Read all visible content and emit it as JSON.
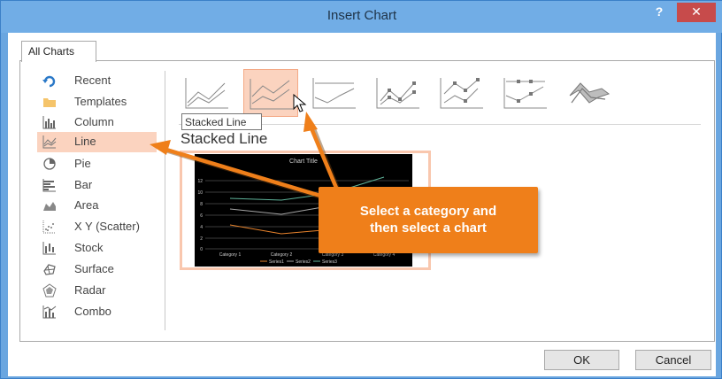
{
  "window": {
    "title": "Insert Chart",
    "help_label": "?",
    "close_label": "✕"
  },
  "tabs": [
    {
      "label": "All Charts"
    }
  ],
  "sidebar": {
    "items": [
      {
        "label": "Recent",
        "icon": "recent-icon"
      },
      {
        "label": "Templates",
        "icon": "folder-icon"
      },
      {
        "label": "Column",
        "icon": "column-chart-icon"
      },
      {
        "label": "Line",
        "icon": "line-chart-icon",
        "selected": true
      },
      {
        "label": "Pie",
        "icon": "pie-chart-icon"
      },
      {
        "label": "Bar",
        "icon": "bar-chart-icon"
      },
      {
        "label": "Area",
        "icon": "area-chart-icon"
      },
      {
        "label": "X Y (Scatter)",
        "icon": "scatter-chart-icon"
      },
      {
        "label": "Stock",
        "icon": "stock-chart-icon"
      },
      {
        "label": "Surface",
        "icon": "surface-chart-icon"
      },
      {
        "label": "Radar",
        "icon": "radar-chart-icon"
      },
      {
        "label": "Combo",
        "icon": "combo-chart-icon"
      }
    ]
  },
  "subtypes": {
    "selected_index": 1,
    "items": [
      {
        "icon": "line-chart-icon"
      },
      {
        "icon": "stacked-line-chart-icon"
      },
      {
        "icon": "100-percent-stacked-line-chart-icon"
      },
      {
        "icon": "line-with-markers-chart-icon"
      },
      {
        "icon": "stacked-line-with-markers-chart-icon"
      },
      {
        "icon": "100-percent-stacked-line-with-markers-chart-icon"
      },
      {
        "icon": "3d-line-chart-icon"
      }
    ]
  },
  "tooltip": "Stacked Line",
  "preview": {
    "heading": "Stacked Line",
    "chart_title": "Chart Title",
    "y_ticks": [
      "0",
      "2",
      "4",
      "6",
      "8",
      "10",
      "12"
    ],
    "categories": [
      "Category 1",
      "Category 2",
      "Category 3",
      "Category 4"
    ],
    "legend": [
      "Series1",
      "Series2",
      "Series3"
    ],
    "series_colors": [
      "#4d7ec2",
      "#e8832c",
      "#a5a5a5"
    ]
  },
  "callout": {
    "line1": "Select a category and",
    "line2": "then select a chart",
    "color": "#ef7f1a"
  },
  "buttons": {
    "ok": "OK",
    "cancel": "Cancel"
  }
}
